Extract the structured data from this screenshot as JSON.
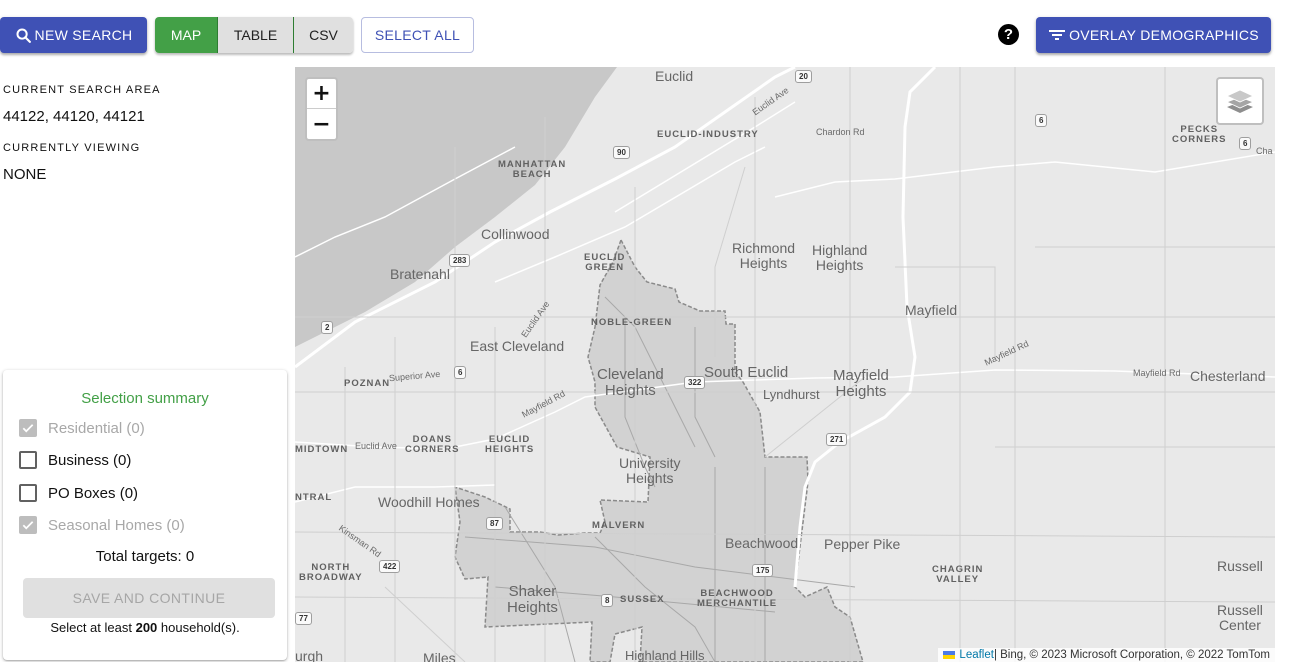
{
  "toolbar": {
    "new_search_label": "NEW SEARCH",
    "view_toggle": [
      {
        "label": "MAP",
        "active": true
      },
      {
        "label": "TABLE",
        "active": false
      },
      {
        "label": "CSV",
        "active": false
      }
    ],
    "select_all_label": "SELECT ALL",
    "help_icon": "?",
    "overlay_label": "OVERLAY DEMOGRAPHICS",
    "colors": {
      "primary": "#3f51b5",
      "active_toggle": "#43a047",
      "inactive_toggle": "#e0e0e0"
    }
  },
  "sidebar": {
    "current_search_area_label": "CURRENT SEARCH AREA",
    "current_search_area_value": "44122, 44120, 44121",
    "currently_viewing_label": "CURRENTLY VIEWING",
    "currently_viewing_value": "NONE"
  },
  "summary": {
    "title": "Selection summary",
    "items": [
      {
        "label": "Residential (0)",
        "checked": true,
        "disabled": true
      },
      {
        "label": "Business (0)",
        "checked": false,
        "disabled": false
      },
      {
        "label": "PO Boxes (0)",
        "checked": false,
        "disabled": false
      },
      {
        "label": "Seasonal Homes (0)",
        "checked": true,
        "disabled": true
      }
    ],
    "total_label": "Total targets: 0",
    "save_label": "SAVE AND CONTINUE",
    "hint_prefix": "Select at least ",
    "hint_count": "200",
    "hint_suffix": " household(s)."
  },
  "map": {
    "zoom_in": "+",
    "zoom_out": "−",
    "attribution": {
      "leaflet_link": "Leaflet",
      "text": " | Bing, © 2023 Microsoft Corporation, © 2022 TomTom"
    },
    "labels": {
      "euclid": "Euclid",
      "euclid_industry": "EUCLID-INDUSTRY",
      "manhattan_beach_1": "MANHATTAN",
      "manhattan_beach_2": "BEACH",
      "collinwood": "Collinwood",
      "bratenahl": "Bratenahl",
      "euclid_green_1": "EUCLID",
      "euclid_green_2": "GREEN",
      "richmond_heights_1": "Richmond",
      "richmond_heights_2": "Heights",
      "highland_heights_1": "Highland",
      "highland_heights_2": "Heights",
      "mayfield": "Mayfield",
      "pecks_corners_1": "PECKS",
      "pecks_corners_2": "CORNERS",
      "noble_green": "NOBLE-GREEN",
      "east_cleveland": "East Cleveland",
      "cleveland_heights_1": "Cleveland",
      "cleveland_heights_2": "Heights",
      "south_euclid": "South Euclid",
      "lyndhurst": "Lyndhurst",
      "mayfield_heights_1": "Mayfield",
      "mayfield_heights_2": "Heights",
      "chesterland": "Chesterland",
      "poznan": "POZNAN",
      "doans_corners_1": "DOANS",
      "doans_corners_2": "CORNERS",
      "euclid_heights_1": "EUCLID",
      "euclid_heights_2": "HEIGHTS",
      "midtown": "MIDTOWN",
      "university_heights_1": "University",
      "university_heights_2": "Heights",
      "central": "NTRAL",
      "woodhill_homes": "Woodhill Homes",
      "malvern": "MALVERN",
      "beachwood": "Beachwood",
      "pepper_pike": "Pepper Pike",
      "north_broadway_1": "NORTH",
      "north_broadway_2": "BROADWAY",
      "shaker_heights_1": "Shaker",
      "shaker_heights_2": "Heights",
      "sussex": "SUSSEX",
      "beachwood_merchantile_1": "BEACHWOOD",
      "beachwood_merchantile_2": "MERCHANTILE",
      "chagrin_valley_1": "CHAGRIN",
      "chagrin_valley_2": "VALLEY",
      "russell": "Russell",
      "russell_center_1": "Russell",
      "russell_center_2": "Center",
      "highland_hills": "Highland Hills",
      "miles": "Miles",
      "burgh": "urgh"
    },
    "roads": {
      "euclid_ave_ne": "Euclid Ave",
      "chardon_rd": "Chardon Rd",
      "euclid_ave_mid": "Euclid Ave",
      "superior_ave": "Superior Ave",
      "mayfield_rd_w": "Mayfield Rd",
      "mayfield_rd_e": "Mayfield Rd",
      "mayfield_rd_far": "Mayfield Rd",
      "euclid_ave_w": "Euclid Ave",
      "kinsman_rd": "Kinsman Rd",
      "chardon_e": "Cha"
    },
    "shields": {
      "i90": "90",
      "us20": "20",
      "us6_a": "6",
      "us6_b": "6",
      "us6_c": "6",
      "sr283": "283",
      "sr2": "2",
      "us322": "322",
      "i271": "271",
      "sr87": "87",
      "us422": "422",
      "sr175": "175",
      "sr8": "8",
      "i77": "77"
    }
  }
}
